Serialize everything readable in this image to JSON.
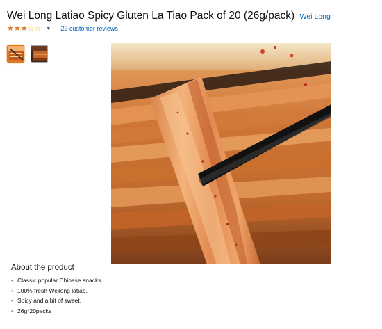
{
  "product": {
    "title": "Wei Long Latiao Spicy Gluten La Tiao Pack of 20 (26g/pack)",
    "brand": "Wei Long",
    "rating": 3,
    "rating_max": 5,
    "reviews_label": "22 customer reviews"
  },
  "gallery": {
    "thumbnails": [
      "latiao-pack-thumbnail",
      "latiao-strip-thumbnail"
    ],
    "main_image": "latiao-held-by-chopsticks"
  },
  "about": {
    "heading": "About the product",
    "bullets": [
      "Classic popular Chinese snacks.",
      "100% fresh Weilong latiao.",
      "Spicy and a bit of sweet.",
      "26g*20packs"
    ]
  },
  "colors": {
    "link": "#0066c0",
    "star": "#de7921",
    "thumb_active_border": "#e77600"
  }
}
